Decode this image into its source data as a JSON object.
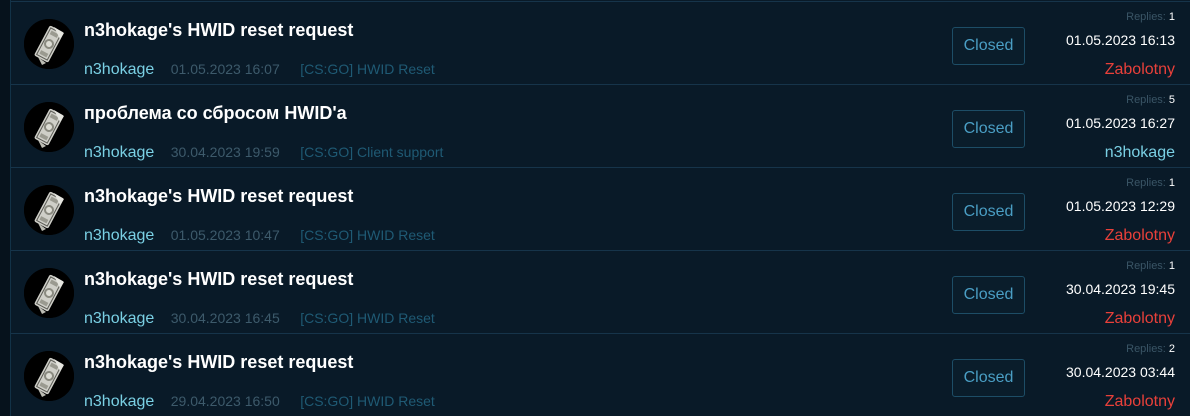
{
  "colors": {
    "background": "#091a28",
    "author": "#7ad0e4",
    "admin": "#e8403a",
    "status_border": "#1d4d66",
    "status_text": "#4a9ec4"
  },
  "replies_label": "Replies:",
  "threads": [
    {
      "title": "n3hokage's HWID reset request",
      "author": "n3hokage",
      "created": "01.05.2023 16:07",
      "forum": "[CS:GO] HWID Reset",
      "status": "Closed",
      "replies": "1",
      "last_post_date": "01.05.2023 16:13",
      "last_post_user": "Zabolotny",
      "last_post_user_color": "#e8403a",
      "avatar_icon": "dollar-bill-avatar-icon"
    },
    {
      "title": "проблема со сбросом HWID'a",
      "author": "n3hokage",
      "created": "30.04.2023 19:59",
      "forum": "[CS:GO] Client support",
      "status": "Closed",
      "replies": "5",
      "last_post_date": "01.05.2023 16:27",
      "last_post_user": "n3hokage",
      "last_post_user_color": "#7ad0e4",
      "avatar_icon": "dollar-bill-avatar-icon"
    },
    {
      "title": "n3hokage's HWID reset request",
      "author": "n3hokage",
      "created": "01.05.2023 10:47",
      "forum": "[CS:GO] HWID Reset",
      "status": "Closed",
      "replies": "1",
      "last_post_date": "01.05.2023 12:29",
      "last_post_user": "Zabolotny",
      "last_post_user_color": "#e8403a",
      "avatar_icon": "dollar-bill-avatar-icon"
    },
    {
      "title": "n3hokage's HWID reset request",
      "author": "n3hokage",
      "created": "30.04.2023 16:45",
      "forum": "[CS:GO] HWID Reset",
      "status": "Closed",
      "replies": "1",
      "last_post_date": "30.04.2023 19:45",
      "last_post_user": "Zabolotny",
      "last_post_user_color": "#e8403a",
      "avatar_icon": "dollar-bill-avatar-icon"
    },
    {
      "title": "n3hokage's HWID reset request",
      "author": "n3hokage",
      "created": "29.04.2023 16:50",
      "forum": "[CS:GO] HWID Reset",
      "status": "Closed",
      "replies": "2",
      "last_post_date": "30.04.2023 03:44",
      "last_post_user": "Zabolotny",
      "last_post_user_color": "#e8403a",
      "avatar_icon": "dollar-bill-avatar-icon"
    }
  ]
}
